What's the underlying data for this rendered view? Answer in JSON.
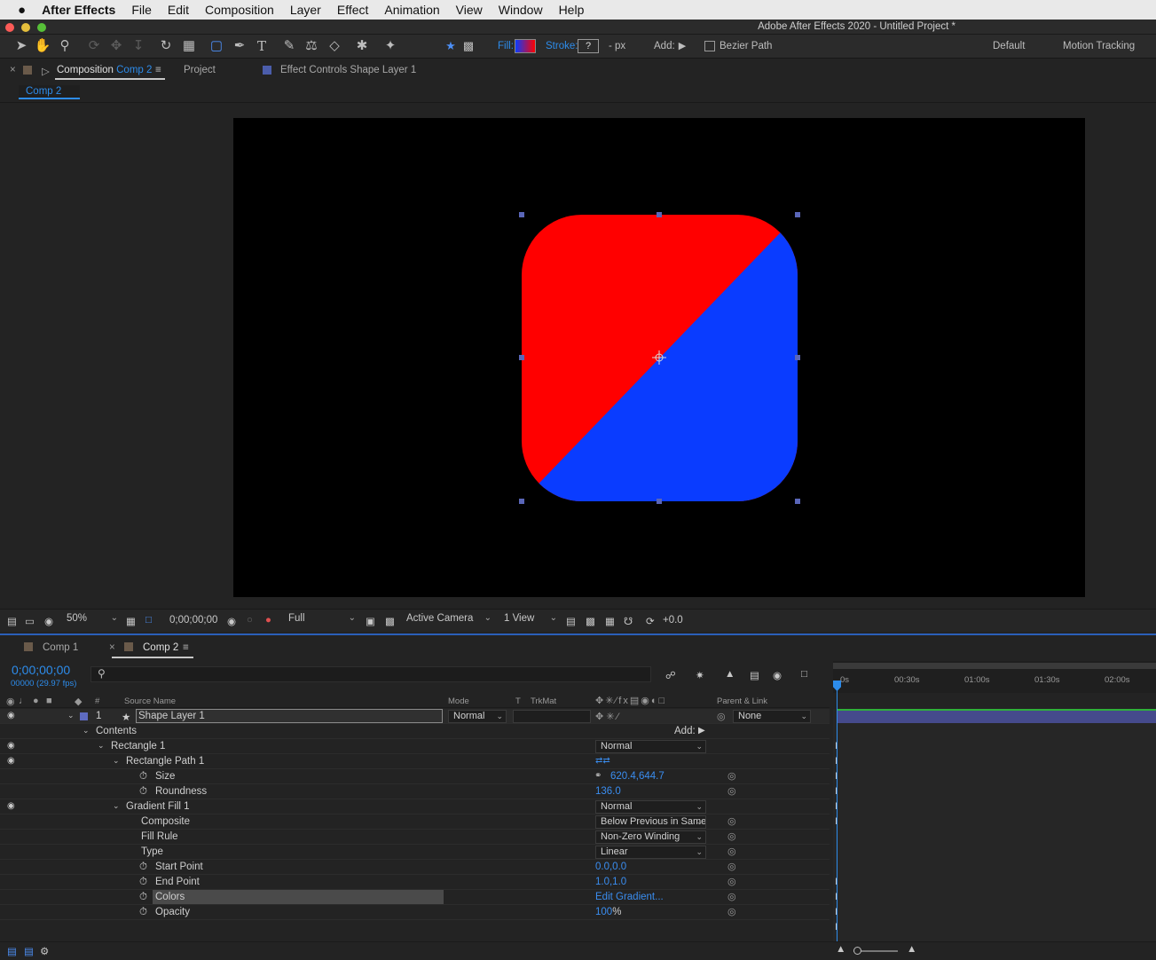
{
  "menubar": {
    "app": "After Effects",
    "items": [
      "File",
      "Edit",
      "Composition",
      "Layer",
      "Effect",
      "Animation",
      "View",
      "Window",
      "Help"
    ]
  },
  "window": {
    "title": "Adobe After Effects 2020 - Untitled Project *"
  },
  "toolbar": {
    "fill_label": "Fill:",
    "stroke_label": "Stroke:",
    "stroke_value": "?",
    "stroke_unit": "- px",
    "add_label": "Add:",
    "bezier_label": "Bezier Path",
    "workspace_default": "Default",
    "workspace_motion": "Motion Tracking",
    "colors": {
      "accent": "#2d8ceb",
      "fill_red": "#ff0000",
      "fill_blue": "#0a3cff"
    }
  },
  "comp_panel": {
    "tab_prefix": "Composition",
    "tab_comp": "Comp 2",
    "tab_project": "Project",
    "tab_effect_controls": "Effect Controls Shape Layer 1",
    "breadcrumb": "Comp 2"
  },
  "viewer_footer": {
    "zoom": "50%",
    "timecode": "0;00;00;00",
    "resolution": "Full",
    "camera": "Active Camera",
    "views": "1 View",
    "exposure": "+0.0"
  },
  "timeline": {
    "tabs": [
      "Comp 1",
      "Comp 2"
    ],
    "timecode": "0;00;00;00",
    "fps": "00000 (29.97 fps)",
    "headers": {
      "num": "#",
      "source": "Source Name",
      "mode": "Mode",
      "t": "T",
      "trkmat": "TrkMat",
      "parent": "Parent & Link"
    },
    "ruler_ticks": [
      "0s",
      "00:30s",
      "01:00s",
      "01:30s",
      "02:00s"
    ],
    "layer": {
      "index": "1",
      "name": "Shape Layer 1",
      "mode": "Normal",
      "parent": "None"
    },
    "rows": {
      "contents": "Contents",
      "add": "Add:",
      "rectangle": "Rectangle 1",
      "rectangle_mode": "Normal",
      "rect_path": "Rectangle Path 1",
      "size_label": "Size",
      "size_value": "620.4,644.7",
      "roundness_label": "Roundness",
      "roundness_value": "136.0",
      "gradient_fill": "Gradient Fill 1",
      "gradient_mode": "Normal",
      "composite_label": "Composite",
      "composite_value": "Below Previous in Same Group",
      "fillrule_label": "Fill Rule",
      "fillrule_value": "Non-Zero Winding",
      "type_label": "Type",
      "type_value": "Linear",
      "start_label": "Start Point",
      "start_value": "0.0,0.0",
      "end_label": "End Point",
      "end_value": "1.0,1.0",
      "colors_label": "Colors",
      "colors_value": "Edit Gradient...",
      "opacity_label": "Opacity",
      "opacity_value": "100",
      "opacity_unit": "%"
    }
  }
}
